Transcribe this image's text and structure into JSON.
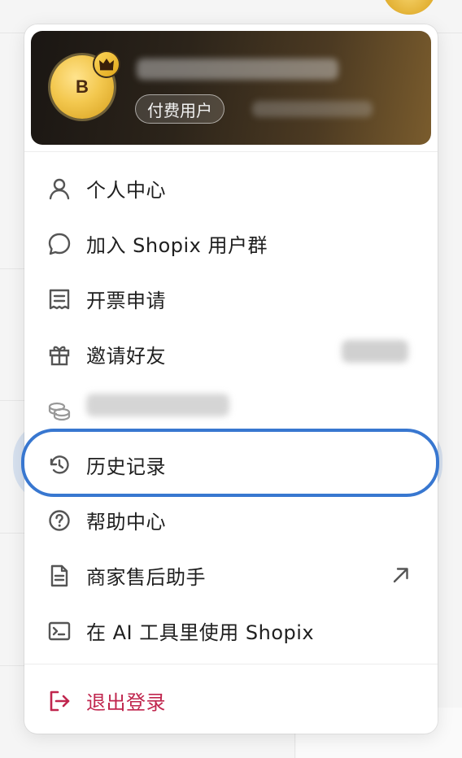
{
  "profile": {
    "avatar_initial": "B",
    "plan_badge": "付费用户"
  },
  "menu": {
    "items": [
      {
        "label": "个人中心",
        "icon": "user-icon"
      },
      {
        "label": "加入 Shopix 用户群",
        "icon": "chat-bubble-icon"
      },
      {
        "label": "开票申请",
        "icon": "invoice-icon"
      },
      {
        "label": "邀请好友",
        "icon": "gift-icon"
      },
      {
        "label": "",
        "icon": "coins-icon"
      },
      {
        "label": "历史记录",
        "icon": "history-icon"
      },
      {
        "label": "帮助中心",
        "icon": "help-icon"
      },
      {
        "label": "商家售后助手",
        "icon": "document-icon",
        "trailing_icon": "external-link-icon"
      },
      {
        "label": "在 AI 工具里使用 Shopix",
        "icon": "terminal-icon"
      }
    ],
    "logout": {
      "label": "退出登录",
      "icon": "logout-icon"
    }
  },
  "colors": {
    "accent": "#3877d0",
    "danger": "#c0264e",
    "text": "#1f1f1f"
  }
}
